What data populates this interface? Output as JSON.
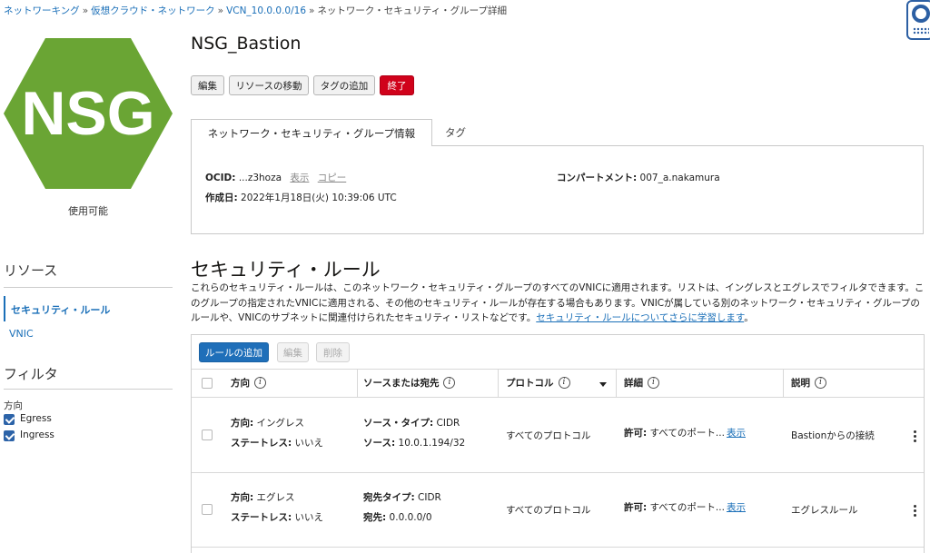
{
  "breadcrumb": {
    "items": [
      "ネットワーキング",
      "仮想クラウド・ネットワーク",
      "VCN_10.0.0.0/16"
    ],
    "current": "ネットワーク・セキュリティ・グループ詳細",
    "separator": "»"
  },
  "resource": {
    "icon_text": "NSG",
    "icon_color": "#6aa534",
    "status": "使用可能",
    "title": "NSG_Bastion"
  },
  "actions": {
    "edit": "編集",
    "move": "リソースの移動",
    "add_tag": "タグの追加",
    "terminate": "終了"
  },
  "tabs": {
    "info": "ネットワーク・セキュリティ・グループ情報",
    "tags": "タグ"
  },
  "info": {
    "ocid_label": "OCID:",
    "ocid_value": "...z3hoza",
    "show": "表示",
    "copy": "コピー",
    "compartment_label": "コンパートメント:",
    "compartment_value": "007_a.nakamura",
    "created_label": "作成日:",
    "created_value": "2022年1月18日(火) 10:39:06 UTC"
  },
  "sidebar": {
    "resources_heading": "リソース",
    "items": [
      "セキュリティ・ルール",
      "VNIC"
    ],
    "filter_heading": "フィルタ",
    "direction_label": "方向",
    "filters": [
      "Egress",
      "Ingress"
    ]
  },
  "section": {
    "title": "セキュリティ・ルール",
    "desc_part1": "これらのセキュリティ・ルールは、このネットワーク・セキュリティ・グループのすべてのVNICに適用されます。リストは、イングレスとエグレスでフィルタできます。このグループの指定されたVNICに適用される、その他のセキュリティ・ルールが存在する場合もあります。VNICが属している別のネットワーク・セキュリティ・グループのルールや、VNICのサブネットに関連付けられたセキュリティ・リストなどです。",
    "desc_link": "セキュリティ・ルールについてさらに学習します",
    "desc_end": "。",
    "add_rule": "ルールの追加",
    "edit": "編集",
    "delete": "削除"
  },
  "table": {
    "headers": {
      "direction": "方向",
      "source_dest": "ソースまたは宛先",
      "protocol": "プロトコル",
      "details": "詳細",
      "description": "説明"
    },
    "info_glyph": "i",
    "rows": [
      {
        "direction_label": "方向:",
        "direction_value": "イングレス",
        "stateless_label": "ステートレス:",
        "stateless_value": "いいえ",
        "type_label": "ソース・タイプ:",
        "type_value": "CIDR",
        "addr_label": "ソース:",
        "addr_value": "10.0.1.194/32",
        "protocol": "すべてのプロトコル",
        "allow_label": "許可:",
        "allow_value": "すべてのポート...",
        "show": "表示",
        "description": "Bastionからの接続"
      },
      {
        "direction_label": "方向:",
        "direction_value": "エグレス",
        "stateless_label": "ステートレス:",
        "stateless_value": "いいえ",
        "type_label": "宛先タイプ:",
        "type_value": "CIDR",
        "addr_label": "宛先:",
        "addr_value": "0.0.0.0/0",
        "protocol": "すべてのプロトコル",
        "allow_label": "許可:",
        "allow_value": "すべてのポート...",
        "show": "表示",
        "description": "エグレスルール"
      }
    ]
  }
}
